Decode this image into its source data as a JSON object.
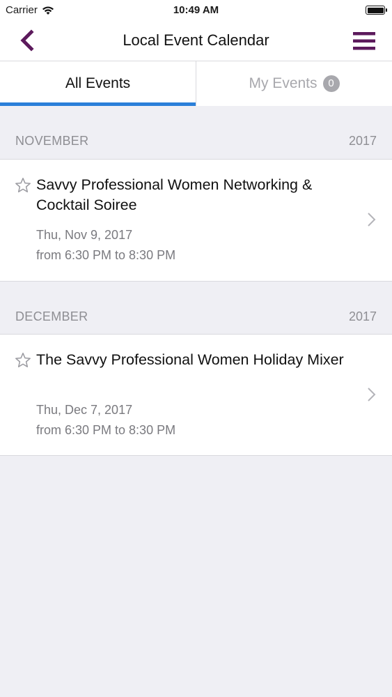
{
  "status_bar": {
    "carrier": "Carrier",
    "time": "10:49 AM"
  },
  "nav": {
    "title": "Local Event Calendar",
    "back_icon": "chevron-left-icon",
    "menu_icon": "hamburger-menu-icon",
    "accent_color": "#5c1a5c"
  },
  "tabs": [
    {
      "label": "All Events",
      "active": true
    },
    {
      "label": "My Events",
      "badge": "0",
      "active": false
    }
  ],
  "sections": [
    {
      "month": "NOVEMBER",
      "year": "2017",
      "events": [
        {
          "title": "Savvy Professional Women Networking & Cocktail Soiree",
          "date": "Thu, Nov 9, 2017",
          "time": "from 6:30 PM to 8:30 PM"
        }
      ]
    },
    {
      "month": "DECEMBER",
      "year": "2017",
      "events": [
        {
          "title": "The Savvy Professional Women Holiday Mixer",
          "date": "Thu, Dec 7, 2017",
          "time": "from 6:30 PM to 8:30 PM"
        }
      ]
    }
  ],
  "colors": {
    "tab_indicator": "#2b7fd9",
    "background": "#efeff4",
    "secondary_text": "#8e8e93"
  }
}
